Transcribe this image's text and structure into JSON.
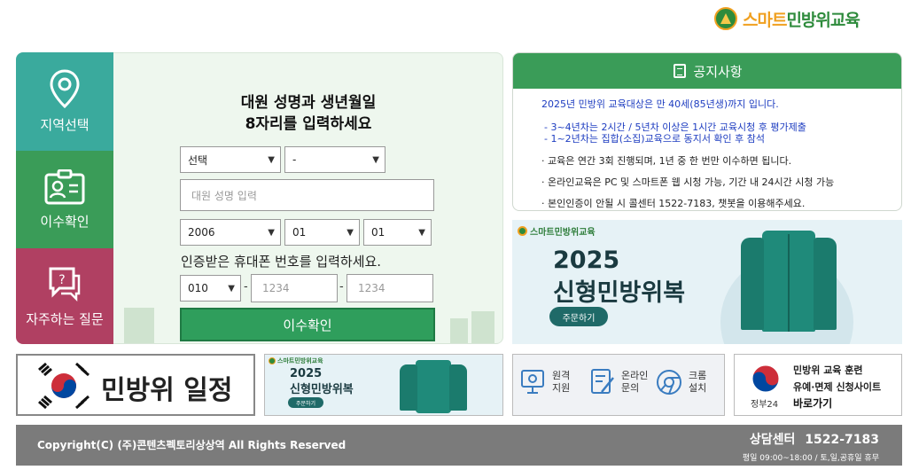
{
  "logo": {
    "part1": "스마트",
    "part2": "민방위교육"
  },
  "nav": [
    {
      "label": "지역선택",
      "icon": "map-pin-icon"
    },
    {
      "label": "이수확인",
      "icon": "id-card-icon"
    },
    {
      "label": "자주하는 질문",
      "icon": "faq-chat-icon"
    }
  ],
  "form": {
    "title_line1": "대원 성명과 생년월일",
    "title_line2": "8자리를 입력하세요",
    "region_select": "선택",
    "district_select": "-",
    "name_placeholder": "대원 성명 입력",
    "year": "2006",
    "month": "01",
    "day": "01",
    "phone_prompt": "인증받은 휴대폰 번호를 입력하세요.",
    "phone_prefix": "010",
    "phone_mid_placeholder": "1234",
    "phone_last_placeholder": "1234",
    "dash": "-",
    "confirm_label": "이수확인"
  },
  "notice": {
    "title": "공지사항",
    "line1": "2025년 민방위 교육대상은 만 40세(85년생)까지 입니다.",
    "line2": "- 3~4년차는 2시간 / 5년차 이상은 1시간 교육시청 후 평가제출",
    "line3": "- 1~2년차는 집합(소집)교육으로 동지서 확인 후 참석",
    "bullet1": "교육은 연간 3회 진행되며, 1년 중 한 번만 이수하면 됩니다.",
    "bullet2": "온라인교육은 PC 및 스마트폰 웹 시청 가능, 기간 내 24시간 시청 가능",
    "bullet3": "본인인증이 안될 시 콜센터 1522-7183, 챗봇을 이용해주세요."
  },
  "uniform_banner": {
    "brand": "스마트민방위교육",
    "year": "2025",
    "title": "신형민방위복",
    "order_button": "주문하기"
  },
  "schedule_banner": {
    "title": "민방위 일정"
  },
  "uniform_banner_small": {
    "brand": "스마트민방위교육",
    "year": "2025",
    "title": "신형민방위복",
    "order_button": "주문하기"
  },
  "tools": [
    {
      "label": "원격\n지원",
      "icon": "remote-support-icon"
    },
    {
      "label": "온라인\n문의",
      "icon": "online-inquiry-icon"
    },
    {
      "label": "크롬\n설치",
      "icon": "chrome-icon"
    }
  ],
  "gov24": {
    "line1": "민방위 교육 훈련",
    "line2": "유예·면제 신청사이트",
    "line3": "바로가기",
    "brand": "정부24"
  },
  "footer": {
    "copyright": "Copyright(C) (주)콘텐츠펙토리상상역 All Rights Reserved",
    "center_label": "상담센터",
    "phone": "1522-7183",
    "hours": "평일 09:00~18:00 / 토,일,공휴일 휴무"
  },
  "colors": {
    "green": "#3a9c58",
    "teal": "#3aaa9d",
    "maroon": "#b04062",
    "notice_blue": "#1d3cc0"
  }
}
